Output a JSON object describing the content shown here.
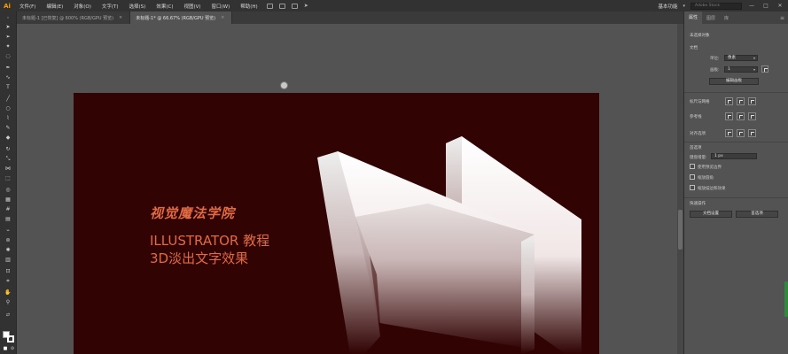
{
  "app": {
    "logo": "Ai"
  },
  "menu": {
    "items": [
      "文件(F)",
      "编辑(E)",
      "对象(O)",
      "文字(T)",
      "选择(S)",
      "效果(C)",
      "视图(V)",
      "窗口(W)",
      "帮助(H)"
    ]
  },
  "topbar": {
    "workspace": "基本功能",
    "search_placeholder": "Adobe Stock",
    "minimize": "—",
    "maximize": "□",
    "close": "✕"
  },
  "tabs": [
    {
      "label": "未标题-1 [已恢复] @ 600% (RGB/GPU 预览)",
      "close": "×"
    },
    {
      "label": "未标题-1* @ 66.67% (RGB/GPU 预览)",
      "close": "×"
    }
  ],
  "artboard": {
    "background": "#310303",
    "title": "视觉魔法学院",
    "line1": "ILLUSTRATOR 教程",
    "line2": "3D淡出文字效果",
    "text_color": "#e06a45"
  },
  "panel": {
    "tabs": [
      "属性",
      "图层",
      "库"
    ],
    "menu_icon": "≡",
    "no_selection": "未选择对象",
    "doc_section": "文档",
    "units_label": "单位:",
    "units_value": "像素",
    "artboard_label": "画板:",
    "artboard_value": "1",
    "edit_artboard_button": "编辑画板",
    "ruler_grid": "标尺与网格",
    "guides": "参考线",
    "snap": "对齐选项",
    "prefs": "首选项",
    "nudge_label": "键盘增量:",
    "nudge_value": "1 px",
    "opt1": "使用预览边界",
    "opt2": "缩放圆角",
    "opt3": "缩放描边和效果",
    "quick_actions": "快速操作",
    "doc_setup_button": "文档设置",
    "prefs_button": "首选项"
  }
}
